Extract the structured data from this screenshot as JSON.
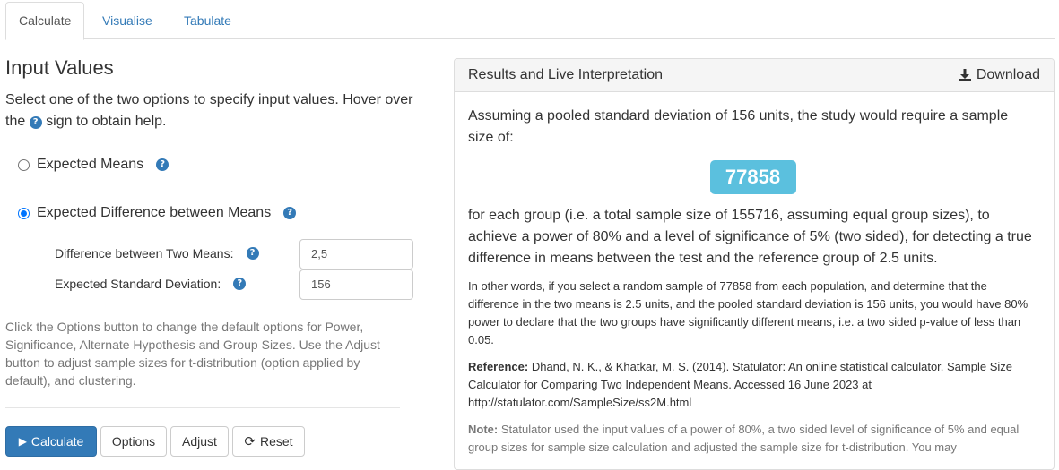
{
  "tabs": [
    {
      "label": "Calculate",
      "active": true
    },
    {
      "label": "Visualise",
      "active": false
    },
    {
      "label": "Tabulate",
      "active": false
    }
  ],
  "left": {
    "heading": "Input Values",
    "intro_part1": "Select one of the two options to specify input values. Hover over the",
    "intro_part2": "sign to obtain help.",
    "help_glyph": "?",
    "options": [
      {
        "label": "Expected Means",
        "checked": false
      },
      {
        "label": "Expected Difference between Means",
        "checked": true
      }
    ],
    "fields": [
      {
        "label": "Difference between Two Means:",
        "value": "2,5"
      },
      {
        "label": "Expected Standard Deviation:",
        "value": "156"
      }
    ],
    "note": "Click the Options button to change the default options for Power, Significance, Alternate Hypothesis and Group Sizes. Use the Adjust button to adjust sample sizes for t-distribution (option applied by default), and clustering.",
    "buttons": {
      "calculate": "Calculate",
      "options": "Options",
      "adjust": "Adjust",
      "reset": "Reset"
    }
  },
  "results": {
    "title": "Results and Live Interpretation",
    "download": "Download",
    "intro": "Assuming a pooled standard deviation of 156 units, the study would require a sample size of:",
    "sample_size": "77858",
    "per_group": "for each group (i.e. a total sample size of 155716, assuming equal group sizes), to achieve a power of 80% and a level of significance of 5% (two sided), for detecting a true difference in means between the test and the reference group of 2.5 units.",
    "other_words": "In other words, if you select a random sample of 77858 from each population, and determine that the difference in the two means is 2.5 units, and the pooled standard deviation is 156 units, you would have 80% power to declare that the two groups have significantly different means, i.e. a two sided p-value of less than 0.05.",
    "reference_label": "Reference:",
    "reference_text": "Dhand, N. K., & Khatkar, M. S. (2014). Statulator: An online statistical calculator. Sample Size Calculator for Comparing Two Independent Means. Accessed 16 June 2023 at http://statulator.com/SampleSize/ss2M.html",
    "note_label": "Note:",
    "note_text": "Statulator used the input values of a power of 80%, a two sided level of significance of 5% and equal group sizes for sample size calculation and adjusted the sample size for t-distribution. You may"
  }
}
